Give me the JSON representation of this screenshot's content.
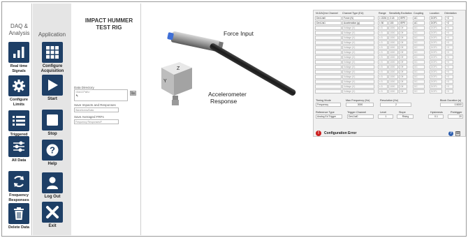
{
  "nav_primary": {
    "title": "DAQ & Analysis",
    "items": [
      {
        "label": "Real time Signals",
        "icon": "bar-chart-icon"
      },
      {
        "label": "Configure Limits",
        "icon": "gear-icon"
      },
      {
        "label": "Triggered Signals",
        "icon": "list-icon"
      },
      {
        "label": "All Data",
        "icon": "sliders-icon"
      },
      {
        "label": "Frequency Responses",
        "icon": "refresh-icon"
      },
      {
        "label": "Delete Data",
        "icon": "trash-icon"
      }
    ]
  },
  "nav_secondary": {
    "title": "Application",
    "items": [
      {
        "label": "Configure Acquisition",
        "icon": "grid-icon"
      },
      {
        "label": "Start",
        "icon": "play-icon"
      },
      {
        "label": "Stop",
        "icon": "stop-icon"
      },
      {
        "label": "Help",
        "icon": "question-icon"
      },
      {
        "label": "Log Out",
        "icon": "user-icon"
      },
      {
        "label": "Exit",
        "icon": "close-icon"
      }
    ]
  },
  "test_rig": {
    "title_line1": "IMPACT HUMMER",
    "title_line2": "TEST RIG"
  },
  "directory": {
    "data_directory_label": "Data Directory",
    "data_directory_value": "<Not A Path>",
    "save_impacts_label": "Save Impacts and Responses",
    "save_impacts_value": "Waveforms/Data",
    "save_averaged_label": "Save Averaged FRFs",
    "save_averaged_value": "Frequency Responses/F"
  },
  "image_labels": {
    "force_input": "Force Input",
    "accel_line1": "Accelerometer",
    "accel_line2": "Response"
  },
  "config": {
    "columns": [
      "NI-DAQmx Channel",
      "Channel Type (EU)",
      "Range",
      "Sensitivity",
      "Excitation",
      "Coupling",
      "Location",
      "Orientation"
    ],
    "rows": [
      {
        "channel": "Dev1/ai0",
        "type": "Force (N)",
        "range": "± 2226",
        "sens": "2.18",
        "exc": "IEPE",
        "coupling": "AC",
        "loc": "DOF1",
        "orient": "+Z",
        "active": true
      },
      {
        "channel": "Dev1/ai1",
        "type": "Acceleration (g)",
        "range": "± 50",
        "sens": "100",
        "exc": "IEPE",
        "coupling": "AC",
        "loc": "DOF1",
        "orient": "+Z",
        "active": true
      },
      {
        "channel": "",
        "type": "Voltage (V)",
        "range": "± 5",
        "sens": "1000",
        "exc": "Off",
        "coupling": "DC",
        "loc": "DOF1",
        "orient": "+X",
        "active": false
      },
      {
        "channel": "",
        "type": "Voltage (V)",
        "range": "± 5",
        "sens": "1000",
        "exc": "Off",
        "coupling": "DC",
        "loc": "DOF1",
        "orient": "+X",
        "active": false
      },
      {
        "channel": "",
        "type": "Voltage (V)",
        "range": "± 5",
        "sens": "1000",
        "exc": "Off",
        "coupling": "DC",
        "loc": "DOF1",
        "orient": "+X",
        "active": false
      },
      {
        "channel": "",
        "type": "Voltage (V)",
        "range": "± 5",
        "sens": "1000",
        "exc": "Off",
        "coupling": "DC",
        "loc": "DOF1",
        "orient": "+X",
        "active": false
      },
      {
        "channel": "",
        "type": "Voltage (V)",
        "range": "± 5",
        "sens": "1000",
        "exc": "Off",
        "coupling": "DC",
        "loc": "DOF1",
        "orient": "+X",
        "active": false
      },
      {
        "channel": "",
        "type": "Voltage (V)",
        "range": "± 5",
        "sens": "1000",
        "exc": "Off",
        "coupling": "DC",
        "loc": "DOF1",
        "orient": "+X",
        "active": false
      },
      {
        "channel": "",
        "type": "Voltage (V)",
        "range": "± 5",
        "sens": "1000",
        "exc": "Off",
        "coupling": "DC",
        "loc": "DOF1",
        "orient": "+X",
        "active": false
      },
      {
        "channel": "",
        "type": "Voltage (V)",
        "range": "± 5",
        "sens": "1000",
        "exc": "Off",
        "coupling": "DC",
        "loc": "DOF1",
        "orient": "+X",
        "active": false
      },
      {
        "channel": "",
        "type": "Voltage (V)",
        "range": "± 5",
        "sens": "1000",
        "exc": "Off",
        "coupling": "DC",
        "loc": "DOF1",
        "orient": "+X",
        "active": false
      },
      {
        "channel": "",
        "type": "Voltage (V)",
        "range": "± 5",
        "sens": "1000",
        "exc": "Off",
        "coupling": "DC",
        "loc": "DOF1",
        "orient": "+X",
        "active": false
      },
      {
        "channel": "",
        "type": "Voltage (V)",
        "range": "± 5",
        "sens": "1000",
        "exc": "Off",
        "coupling": "DC",
        "loc": "DOF1",
        "orient": "+X",
        "active": false
      },
      {
        "channel": "",
        "type": "Voltage (V)",
        "range": "± 5",
        "sens": "1000",
        "exc": "Off",
        "coupling": "DC",
        "loc": "DOF1",
        "orient": "+X",
        "active": false
      },
      {
        "channel": "",
        "type": "Voltage (V)",
        "range": "± 5",
        "sens": "1000",
        "exc": "Off",
        "coupling": "DC",
        "loc": "DOF1",
        "orient": "+X",
        "active": false
      },
      {
        "channel": "",
        "type": "Voltage (V)",
        "range": "± 5",
        "sens": "1000",
        "exc": "Off",
        "coupling": "DC",
        "loc": "DOF1",
        "orient": "+X",
        "active": false
      }
    ],
    "timing_mode_label": "Timing Mode",
    "timing_mode_value": "Frequency",
    "max_freq_label": "Max Frequency (Hz)",
    "max_freq_value": "3000",
    "resolution_label": "Resolution (Hz)",
    "resolution_value": "2",
    "block_duration_label": "Block Duration (s)",
    "block_duration_value": "0.5000",
    "ref_type_label": "Reference Type",
    "ref_type_value": "Analog Ed Trigger",
    "trigger_channel_label": "Trigger Channel",
    "trigger_channel_value": "Dev1/ai0",
    "level_label": "Level",
    "level_value": "1",
    "slope_label": "Slope",
    "slope_value": "Rising",
    "hysteresis_label": "Hysteresis",
    "hysteresis_value": "0.1",
    "pretrigger_label": "Pretrigger",
    "pretrigger_value": "20",
    "error_text": "Configuration Error"
  },
  "colors": {
    "nav_icon_bg": "#1e3f66",
    "error_red": "#cc1f1f",
    "panel_bg": "#e5e5e5"
  }
}
